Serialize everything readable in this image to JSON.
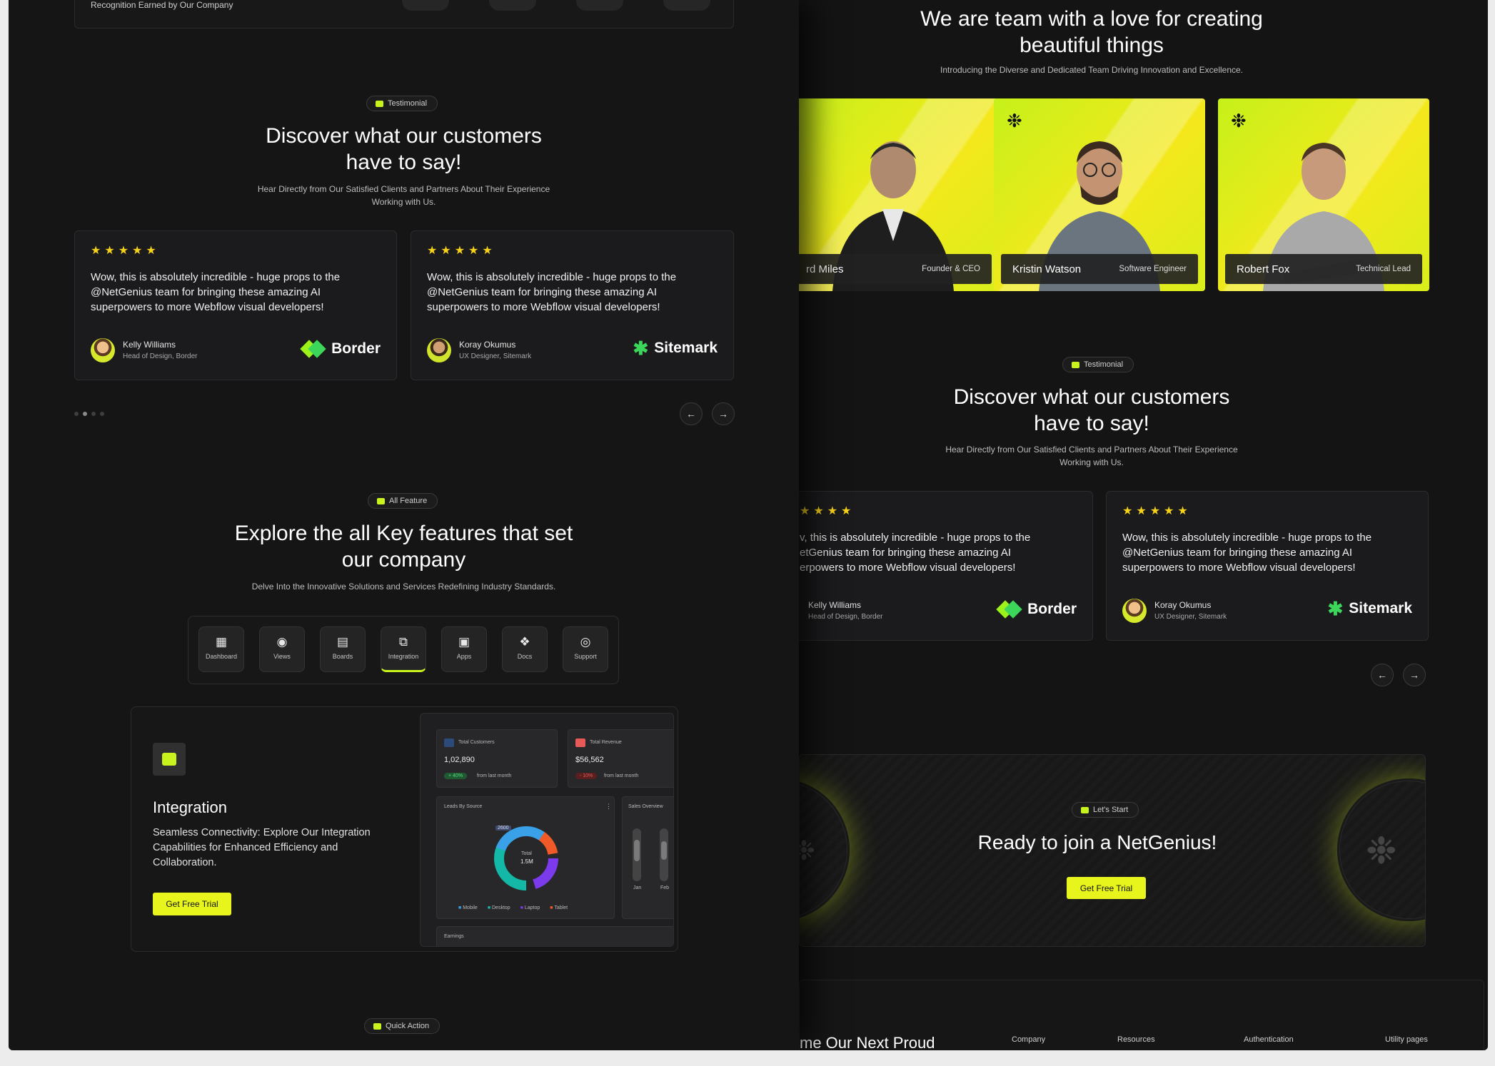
{
  "left": {
    "recognition": {
      "text": "Recognition Earned by Our Company"
    },
    "testimonial": {
      "badge": "Testimonial",
      "title_line1": "Discover what our customers",
      "title_line2": "have to say!",
      "subtitle_line1": "Hear Directly from Our Satisfied Clients and Partners About Their Experience",
      "subtitle_line2": "Working with Us.",
      "reviews": [
        {
          "rating": 5,
          "quote": "Wow, this is absolutely incredible - huge props to the @NetGenius team for bringing these amazing AI superpowers to more Webflow visual developers!",
          "name": "Kelly Williams",
          "role": "Head of Design, Border",
          "logo": "Border"
        },
        {
          "rating": 5,
          "quote": "Wow, this is absolutely incredible - huge props to the @NetGenius team for bringing these amazing AI superpowers to more Webflow visual developers!",
          "name": "Koray Okumus",
          "role": "UX Designer, Sitemark",
          "logo": "Sitemark"
        }
      ],
      "prev_icon": "arrow-left-icon",
      "next_icon": "arrow-right-icon",
      "prev_glyph": "←",
      "next_glyph": "→"
    },
    "features": {
      "badge": "All Feature",
      "title_line1": "Explore the all Key features that set",
      "title_line2": "our company",
      "subtitle": "Delve Into the Innovative Solutions and Services Redefining Industry Standards.",
      "tabs": [
        {
          "label": "Dashboard",
          "icon": "dashboard-icon",
          "glyph": "▦"
        },
        {
          "label": "Views",
          "icon": "eye-icon",
          "glyph": "◉"
        },
        {
          "label": "Boards",
          "icon": "boards-icon",
          "glyph": "▤"
        },
        {
          "label": "Integration",
          "icon": "integration-icon",
          "glyph": "⧉",
          "active": true
        },
        {
          "label": "Apps",
          "icon": "apps-icon",
          "glyph": "▣"
        },
        {
          "label": "Docs",
          "icon": "docs-icon",
          "glyph": "❖"
        },
        {
          "label": "Support",
          "icon": "support-icon",
          "glyph": "◎"
        }
      ],
      "panel": {
        "title": "Integration",
        "description": "Seamless Connectivity: Explore Our Integration Capabilities for Enhanced Efficiency and Collaboration.",
        "cta": "Get Free Trial"
      },
      "dashboard": {
        "total_customers_label": "Total Customers",
        "total_customers_value": "1,02,890",
        "total_customers_change": "+ 40%",
        "total_revenue_label": "Total Revenue",
        "total_revenue_value": "$56,562",
        "total_revenue_change": "- 10%",
        "from_last_month": "from last month",
        "leads_label": "Leads By Source",
        "sales_label": "Sales Overview",
        "earnings_label": "Earnings",
        "donut_center_label": "Total",
        "donut_center_value": "1.5M",
        "donut_tooltip": "2600",
        "legend": [
          "Mobile",
          "Desktop",
          "Laptop",
          "Tablet"
        ],
        "legend_colors": [
          "#3aa0e8",
          "#14b8a6",
          "#7c3aed",
          "#f05a28"
        ],
        "sales_x": [
          "Jan",
          "Feb"
        ]
      }
    },
    "quick_action": {
      "badge": "Quick Action"
    }
  },
  "right": {
    "team": {
      "title_line1": "We are team with a love for creating",
      "title_line2": "beautiful things",
      "subtitle": "Introducing the Diverse and Dedicated Team Driving Innovation and Excellence.",
      "members": [
        {
          "name": "rd Miles",
          "role": "Founder & CEO"
        },
        {
          "name": "Kristin Watson",
          "role": "Software Engineer"
        },
        {
          "name": "Robert Fox",
          "role": "Technical Lead"
        }
      ]
    },
    "testimonial": {
      "badge": "Testimonial",
      "title_line1": "Discover what our customers",
      "title_line2": "have to say!",
      "subtitle_line1": "Hear Directly from Our Satisfied Clients and Partners About Their Experience",
      "subtitle_line2": "Working with Us.",
      "reviews": [
        {
          "rating": 4,
          "quote_lines": [
            "v, this is absolutely incredible - huge props to the",
            "etGenius team for bringing these amazing AI",
            "erpowers to more Webflow visual developers!"
          ],
          "name": "Kelly Williams",
          "role": "Head of Design, Border",
          "logo": "Border"
        },
        {
          "rating": 5,
          "quote": "Wow, this is absolutely incredible - huge props to the @NetGenius team for bringing these amazing AI superpowers to more Webflow visual developers!",
          "name": "Koray Okumus",
          "role": "UX Designer, Sitemark",
          "logo": "Sitemark"
        }
      ]
    },
    "cta": {
      "badge": "Let's Start",
      "title": "Ready to join a NetGenius!",
      "button": "Get Free Trial"
    },
    "footer": {
      "heading": "me Our Next Proud",
      "links": [
        "Company",
        "Resources",
        "Authentication",
        "Utility pages"
      ]
    }
  },
  "colors": {
    "accent": "#c9f31d",
    "star": "#f7d21b",
    "background": "#151515"
  }
}
